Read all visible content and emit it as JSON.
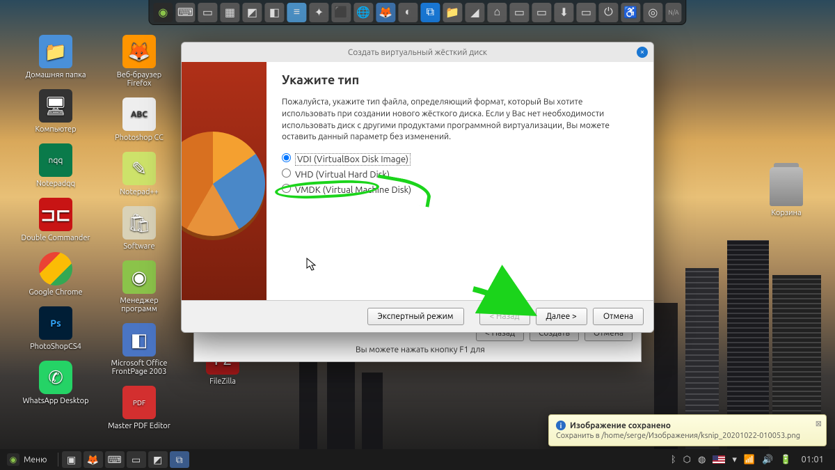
{
  "desktop": {
    "icons_col1": [
      {
        "name": "home-folder",
        "label": "Домашняя папка",
        "cls": "folder",
        "glyph": "📁"
      },
      {
        "name": "computer",
        "label": "Компьютер",
        "cls": "pc",
        "glyph": "🖥"
      },
      {
        "name": "notepadqq",
        "label": "Notepadqq",
        "cls": "nqq",
        "glyph": "nqq"
      },
      {
        "name": "double-commander",
        "label": "Double Commander",
        "cls": "dc",
        "glyph": "⊐⊏"
      },
      {
        "name": "google-chrome",
        "label": "Google Chrome",
        "cls": "chrome",
        "glyph": ""
      },
      {
        "name": "photoshop-cs4",
        "label": "PhotoShopCS4",
        "cls": "ps",
        "glyph": "Ps"
      },
      {
        "name": "whatsapp",
        "label": "WhatsApp Desktop",
        "cls": "wa",
        "glyph": "✆"
      }
    ],
    "icons_col2": [
      {
        "name": "firefox",
        "label": "Веб-браузер Firefox",
        "cls": "ff",
        "glyph": "🦊"
      },
      {
        "name": "photoshop-cc",
        "label": "Photoshop CC",
        "cls": "abc",
        "glyph": "ABC"
      },
      {
        "name": "notepadpp",
        "label": "Notepad++",
        "cls": "npp",
        "glyph": "✎"
      },
      {
        "name": "software",
        "label": "Software",
        "cls": "sw",
        "glyph": "🛍"
      },
      {
        "name": "program-manager",
        "label": "Менеджер программ",
        "cls": "mp",
        "glyph": "◉"
      },
      {
        "name": "frontpage",
        "label": "Microsoft Office FrontPage 2003",
        "cls": "fp",
        "glyph": "◧"
      },
      {
        "name": "master-pdf",
        "label": "Master PDF Editor",
        "cls": "pdf",
        "glyph": "PDF"
      }
    ],
    "icons_col3": [
      {
        "name": "filezilla",
        "label": "FileZilla",
        "cls": "fz",
        "glyph": "Fz"
      }
    ],
    "trash_label": "Корзина"
  },
  "topdock": {
    "na": "N/A"
  },
  "behind_dialog": {
    "hint": "Вы можете нажать кнопку F1 для",
    "back": "< Назад",
    "create": "Создать",
    "cancel": "Отмена"
  },
  "wizard": {
    "title": "Создать виртуальный жёсткий диск",
    "heading": "Укажите тип",
    "text": "Пожалуйста, укажите тип файла, определяющий формат, который Вы хотите использовать при создании нового жёсткого диска. Если у Вас нет необходимости использовать диск с другими продуктами программной виртуализации, Вы можете оставить данный параметр без изменений.",
    "options": [
      {
        "id": "vdi",
        "label": "VDI (VirtualBox Disk Image)",
        "checked": true
      },
      {
        "id": "vhd",
        "label": "VHD (Virtual Hard Disk)",
        "checked": false
      },
      {
        "id": "vmdk",
        "label": "VMDK (Virtual Machine Disk)",
        "checked": false
      }
    ],
    "expert": "Экспертный режим",
    "back": "< Назад",
    "next": "Далее >",
    "cancel": "Отмена"
  },
  "toast": {
    "title": "Изображение сохранено",
    "body": "Сохранить в /home/serge/Изображения/ksnip_20201022-010053.png"
  },
  "taskbar": {
    "menu": "Меню",
    "clock": "01:01",
    "lang": "⌨"
  }
}
